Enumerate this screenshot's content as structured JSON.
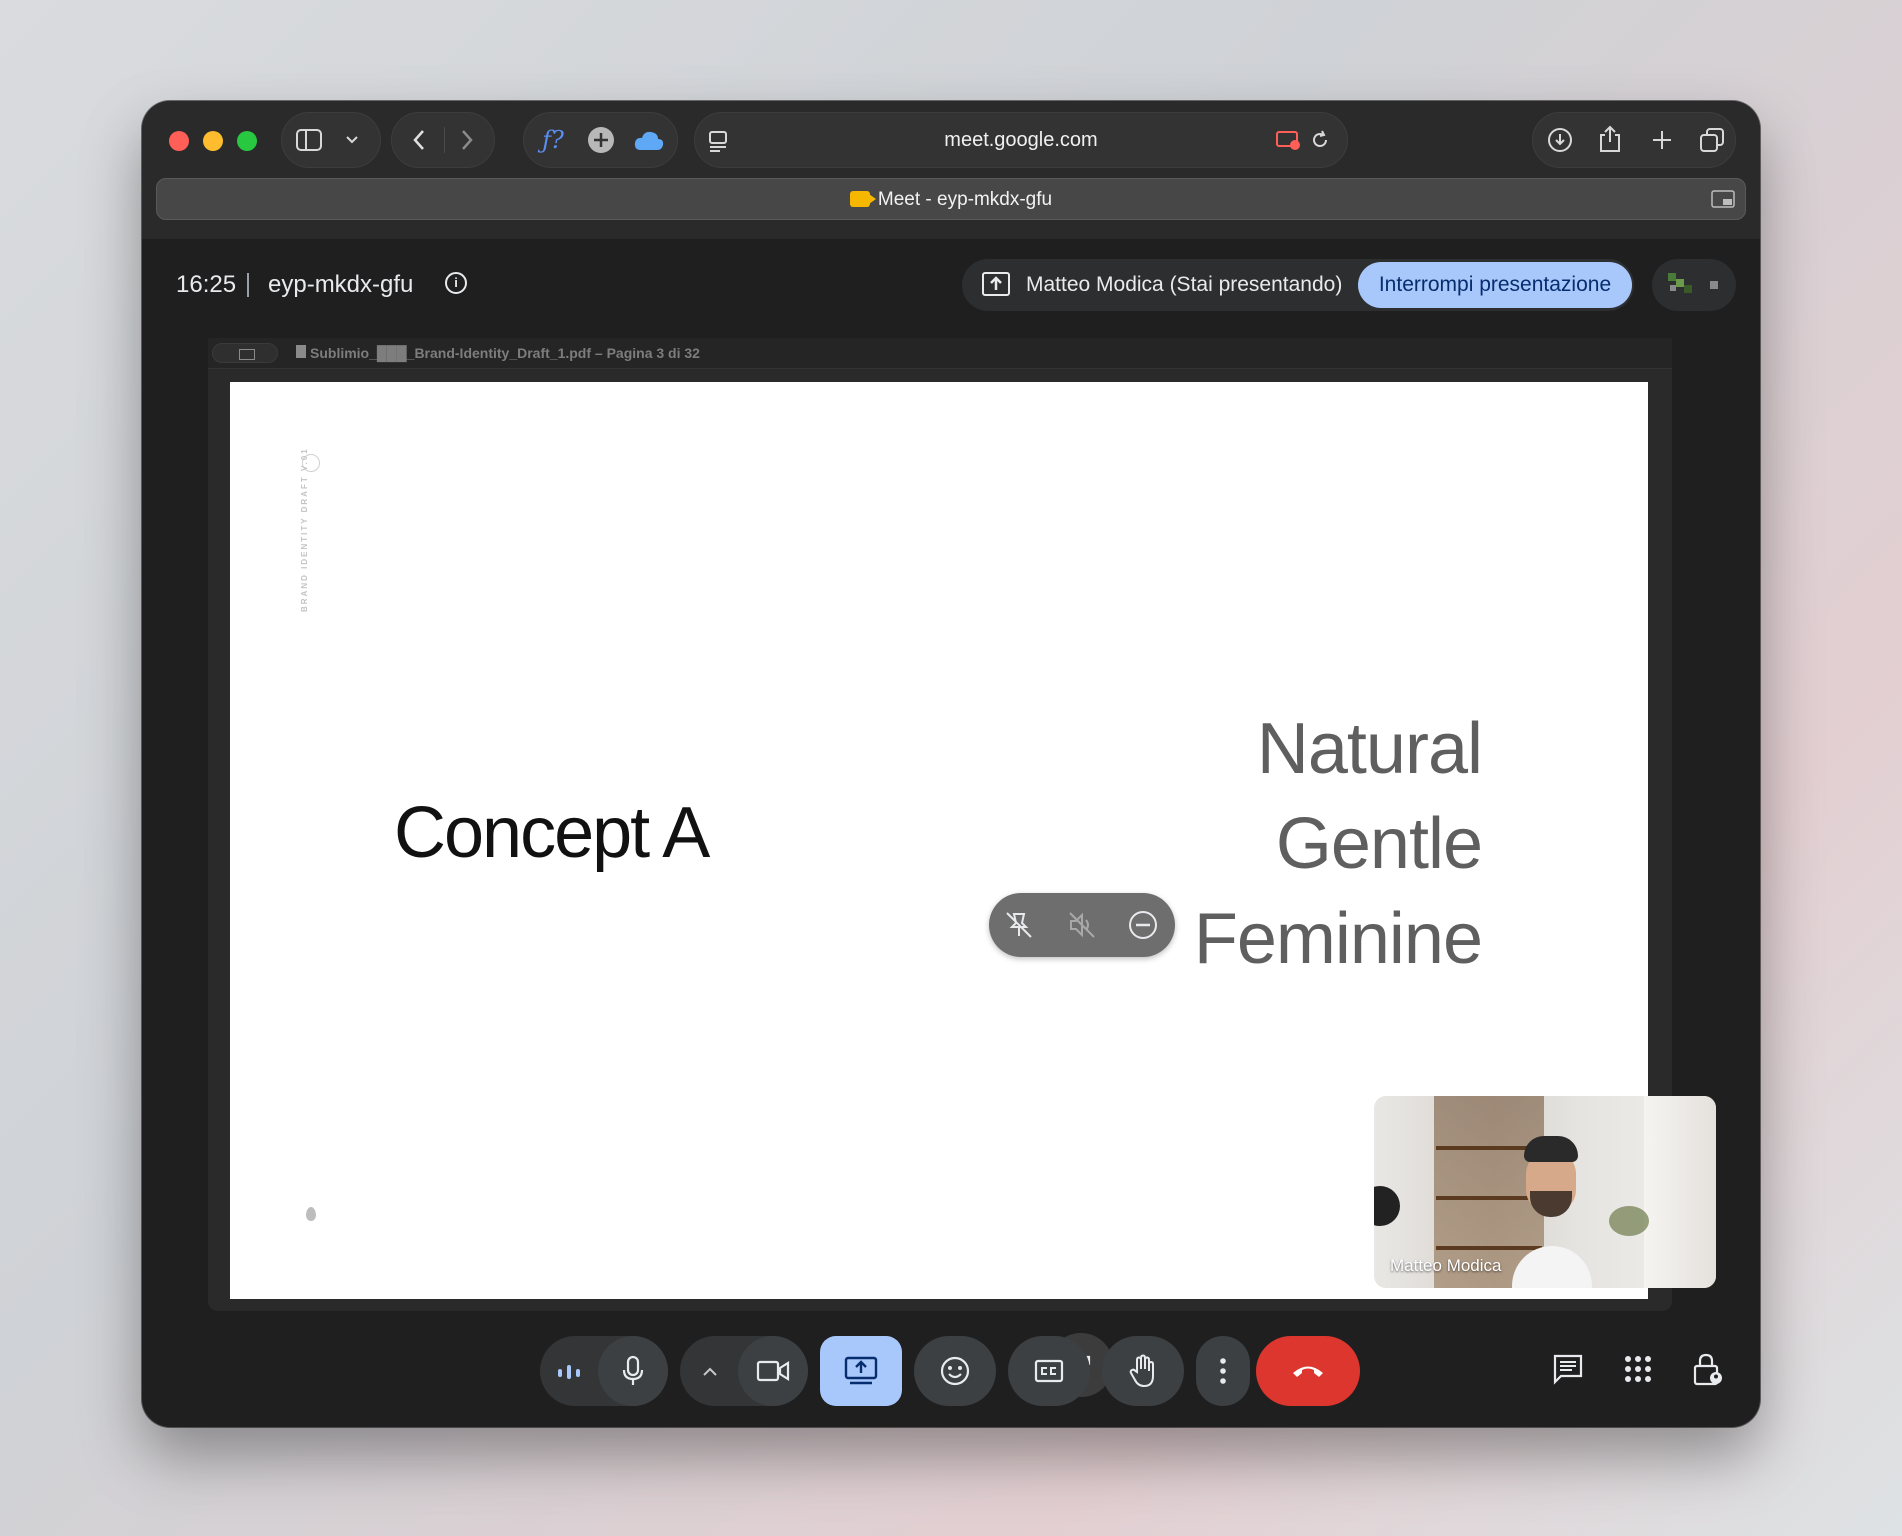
{
  "browser": {
    "url": "meet.google.com",
    "tab_title": "Meet - eyp-mkdx-gfu"
  },
  "meet": {
    "time": "16:25",
    "meeting_code": "eyp-mkdx-gfu",
    "presenter_text": "Matteo Modica (Stai presentando)",
    "stop_presenting_label": "Interrompi presentazione",
    "shared_window_title": "Sublimio_███_Brand-Identity_Draft_1.pdf – Pagina 3 di 32",
    "self_view_name": "Matteo Modica"
  },
  "slide": {
    "vertical_text": "BRAND IDENTITY DRAFT V.01",
    "heading": "Concept A",
    "words": [
      "Natural",
      "Gentle",
      "Feminine"
    ]
  },
  "colors": {
    "accent": "#a8c7fa",
    "end_call": "#ea4335",
    "window_bg": "#1f1f1f"
  },
  "icons": {
    "toolbar": [
      "sidebar-icon",
      "chevron-down-icon",
      "back-icon",
      "forward-icon",
      "function-icon",
      "add-circle-icon",
      "cloud-icon",
      "reader-icon",
      "screen-record-icon",
      "reload-icon",
      "download-icon",
      "share-icon",
      "new-tab-icon",
      "tab-overview-icon"
    ],
    "controls": [
      "audio-level-icon",
      "microphone-icon",
      "chevron-up-icon",
      "camera-icon",
      "present-screen-icon",
      "emoji-icon",
      "captions-icon",
      "raise-hand-icon",
      "more-options-icon",
      "end-call-icon",
      "chat-icon",
      "activities-icon",
      "host-controls-icon"
    ]
  }
}
